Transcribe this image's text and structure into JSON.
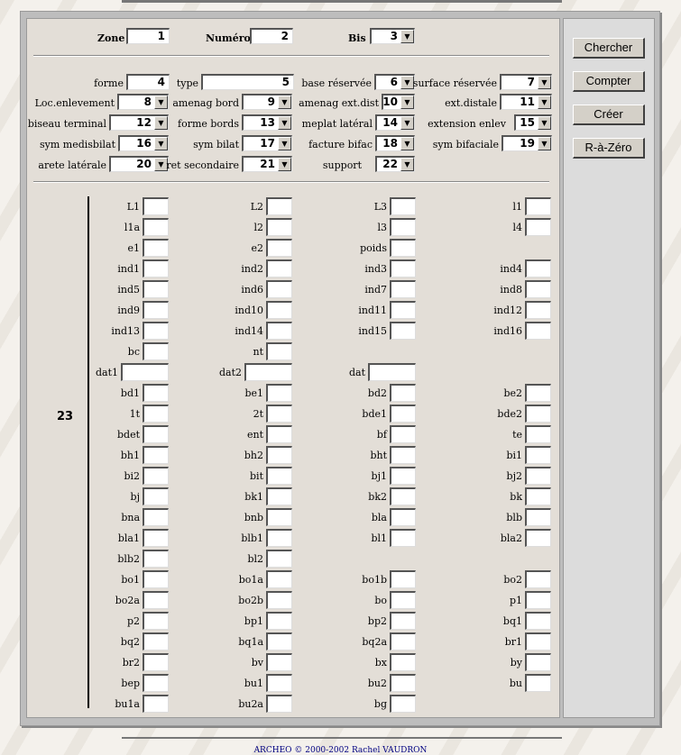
{
  "header": {
    "zone": {
      "label": "Zone",
      "value": "1"
    },
    "numero": {
      "label": "Numéro",
      "value": "2"
    },
    "bis": {
      "label": "Bis",
      "value": "3"
    }
  },
  "attributes": [
    {
      "label": "forme",
      "value": "4"
    },
    {
      "label": "type",
      "value": "5"
    },
    {
      "label": "base réservée",
      "value": "6"
    },
    {
      "label": "surface réservée",
      "value": "7"
    },
    {
      "label": "Loc.enlevement",
      "value": "8"
    },
    {
      "label": "amenag bord",
      "value": "9"
    },
    {
      "label": "amenag ext.dist",
      "value": "10"
    },
    {
      "label": "ext.distale",
      "value": "11"
    },
    {
      "label": "biseau terminal",
      "value": "12"
    },
    {
      "label": "forme bords",
      "value": "13"
    },
    {
      "label": "meplat latéral",
      "value": "14"
    },
    {
      "label": "extension enlev",
      "value": "15"
    },
    {
      "label": "sym medisbilat",
      "value": "16"
    },
    {
      "label": "sym bilat",
      "value": "17"
    },
    {
      "label": "facture bifac",
      "value": "18"
    },
    {
      "label": "sym bifaciale",
      "value": "19"
    },
    {
      "label": "arete latérale",
      "value": "20"
    },
    {
      "label": "ret secondaire",
      "value": "21"
    },
    {
      "label": "support",
      "value": "22"
    }
  ],
  "measures_group_label": "23",
  "measures": [
    [
      "L1",
      "L2",
      "L3",
      "l1"
    ],
    [
      "l1a",
      "l2",
      "l3",
      "l4"
    ],
    [
      "e1",
      "e2",
      "poids",
      ""
    ],
    [
      "ind1",
      "ind2",
      "ind3",
      "ind4"
    ],
    [
      "ind5",
      "ind6",
      "ind7",
      "ind8"
    ],
    [
      "ind9",
      "ind10",
      "ind11",
      "ind12"
    ],
    [
      "ind13",
      "ind14",
      "ind15",
      "ind16"
    ],
    [
      "bc",
      "nt",
      "",
      ""
    ],
    [
      "dat1",
      "dat2",
      "dat",
      ""
    ],
    [
      "bd1",
      "be1",
      "bd2",
      "be2"
    ],
    [
      "1t",
      "2t",
      "bde1",
      "bde2"
    ],
    [
      "bdet",
      "ent",
      "bf",
      "te"
    ],
    [
      "bh1",
      "bh2",
      "bht",
      "bi1"
    ],
    [
      "bi2",
      "bit",
      "bj1",
      "bj2"
    ],
    [
      "bj",
      "bk1",
      "bk2",
      "bk"
    ],
    [
      "bna",
      "bnb",
      "bla",
      "blb"
    ],
    [
      "bla1",
      "blb1",
      "bl1",
      "bla2"
    ],
    [
      "blb2",
      "bl2",
      "",
      ""
    ],
    [
      "bo1",
      "bo1a",
      "bo1b",
      "bo2"
    ],
    [
      "bo2a",
      "bo2b",
      "bo",
      "p1"
    ],
    [
      "p2",
      "bp1",
      "bp2",
      "bq1"
    ],
    [
      "bq2",
      "bq1a",
      "bq2a",
      "br1"
    ],
    [
      "br2",
      "bv",
      "bx",
      "by"
    ],
    [
      "bep",
      "bu1",
      "bu2",
      "bu"
    ],
    [
      "bu1a",
      "bu2a",
      "bg",
      ""
    ]
  ],
  "buttons": [
    "Chercher",
    "Compter",
    "Créer",
    "R-à-Zéro"
  ],
  "footer": "ARCHEO © 2000-2002 Rachel VAUDRON"
}
